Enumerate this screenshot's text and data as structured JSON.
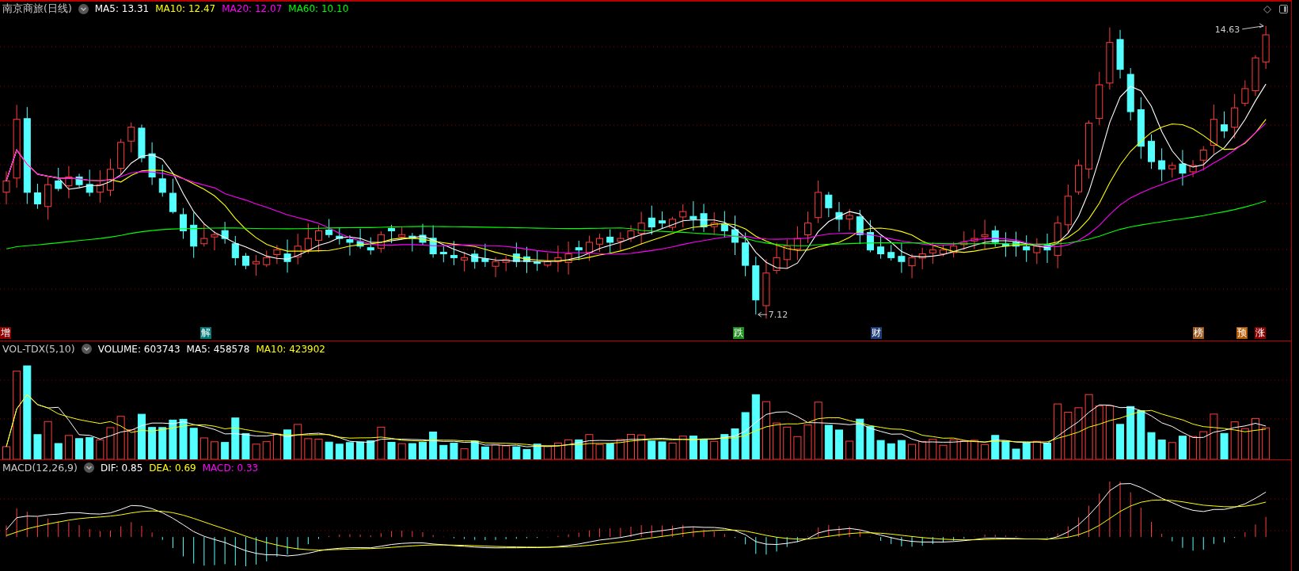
{
  "main_panel": {
    "title": "南京商旅(日线)",
    "indicators": [
      {
        "label": "MA5: 13.31",
        "color": "#ffffff"
      },
      {
        "label": "MA10: 12.47",
        "color": "#ffff00"
      },
      {
        "label": "MA20: 12.07",
        "color": "#ff00ff"
      },
      {
        "label": "MA60: 10.10",
        "color": "#00ff00"
      }
    ],
    "high_label": "14.63",
    "low_label": "7.12",
    "event_markers": [
      {
        "text": "增",
        "color": "#8c0000"
      },
      {
        "text": "解",
        "color": "#007878"
      },
      {
        "text": "跌",
        "color": "#1e8c1e"
      },
      {
        "text": "财",
        "color": "#1e3c78"
      },
      {
        "text": "榜",
        "color": "#9c5a1e"
      },
      {
        "text": "预",
        "color": "#b45a00"
      },
      {
        "text": "涨",
        "color": "#8c0000"
      }
    ]
  },
  "volume_panel": {
    "title": "VOL-TDX(5,10)",
    "indicators": [
      {
        "label": "VOLUME: 603743",
        "color": "#ffffff"
      },
      {
        "label": "MA5: 458578",
        "color": "#ffffff"
      },
      {
        "label": "MA10: 423902",
        "color": "#ffff00"
      }
    ]
  },
  "macd_panel": {
    "title": "MACD(12,26,9)",
    "indicators": [
      {
        "label": "DIF: 0.85",
        "color": "#ffffff"
      },
      {
        "label": "DEA: 0.69",
        "color": "#ffff00"
      },
      {
        "label": "MACD: 0.33",
        "color": "#ff00ff"
      }
    ]
  }
}
